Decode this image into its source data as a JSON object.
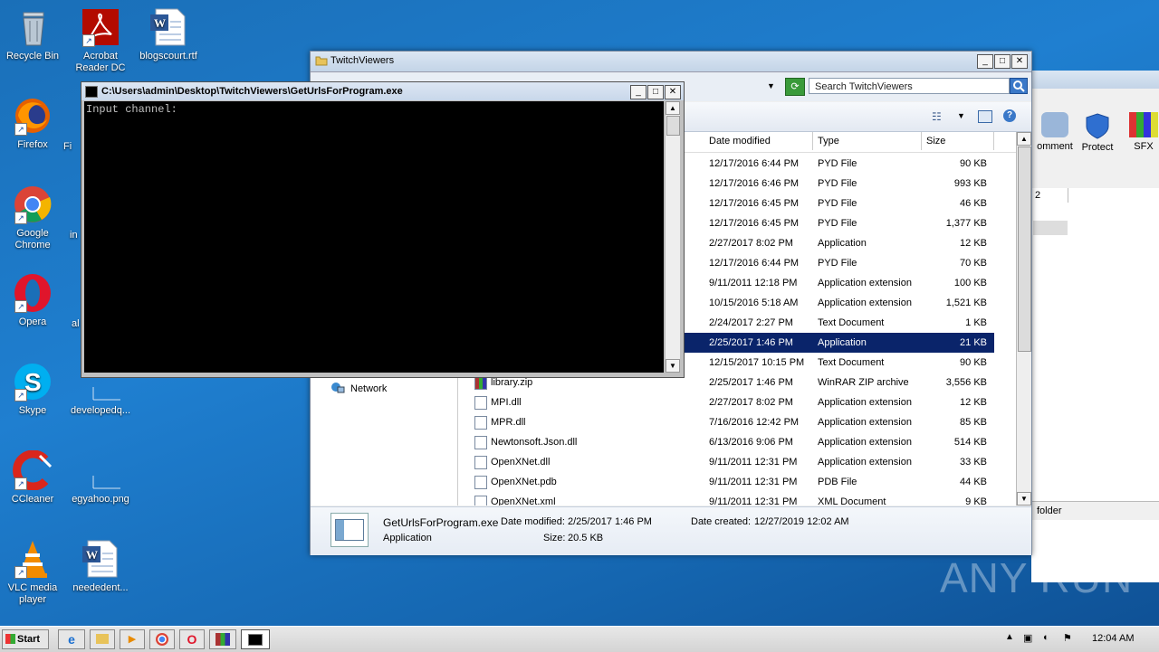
{
  "desktop": {
    "icons": [
      {
        "label": "Recycle Bin",
        "icon": "recycle-bin-icon"
      },
      {
        "label": "Acrobat Reader DC",
        "icon": "acrobat-icon"
      },
      {
        "label": "blogscourt.rtf",
        "icon": "word-doc-icon"
      },
      {
        "label": "Firefox",
        "icon": "firefox-icon"
      },
      {
        "label": "Fi",
        "icon": "file-icon"
      },
      {
        "label": "Google Chrome",
        "icon": "chrome-icon"
      },
      {
        "label": "in",
        "icon": "file-icon"
      },
      {
        "label": "Opera",
        "icon": "opera-icon"
      },
      {
        "label": "al",
        "icon": "file-icon"
      },
      {
        "label": "Skype",
        "icon": "skype-icon"
      },
      {
        "label": "developedq...",
        "icon": "file-icon"
      },
      {
        "label": "CCleaner",
        "icon": "ccleaner-icon"
      },
      {
        "label": "egyahoo.png",
        "icon": "image-file-icon"
      },
      {
        "label": "VLC media player",
        "icon": "vlc-icon"
      },
      {
        "label": "neededent...",
        "icon": "word-doc-icon"
      }
    ]
  },
  "explorer": {
    "title": "TwitchViewers",
    "search_placeholder": "Search TwitchViewers",
    "nav_network": "Network",
    "columns": {
      "date": "Date modified",
      "type": "Type",
      "size": "Size"
    },
    "rows": [
      {
        "name": "",
        "date": "12/17/2016 6:44 PM",
        "type": "PYD File",
        "size": "90 KB"
      },
      {
        "name": "",
        "date": "12/17/2016 6:46 PM",
        "type": "PYD File",
        "size": "993 KB"
      },
      {
        "name": "",
        "date": "12/17/2016 6:45 PM",
        "type": "PYD File",
        "size": "46 KB"
      },
      {
        "name": "",
        "date": "12/17/2016 6:45 PM",
        "type": "PYD File",
        "size": "1,377 KB"
      },
      {
        "name": "",
        "date": "2/27/2017 8:02 PM",
        "type": "Application",
        "size": "12 KB"
      },
      {
        "name": "",
        "date": "12/17/2016 6:44 PM",
        "type": "PYD File",
        "size": "70 KB"
      },
      {
        "name": "",
        "date": "9/11/2011 12:18 PM",
        "type": "Application extension",
        "size": "100 KB"
      },
      {
        "name": "",
        "date": "10/15/2016 5:18 AM",
        "type": "Application extension",
        "size": "1,521 KB"
      },
      {
        "name": "",
        "date": "2/24/2017 2:27 PM",
        "type": "Text Document",
        "size": "1 KB"
      },
      {
        "name": "",
        "date": "2/25/2017 1:46 PM",
        "type": "Application",
        "size": "21 KB",
        "selected": true
      },
      {
        "name": "",
        "date": "12/15/2017 10:15 PM",
        "type": "Text Document",
        "size": "90 KB"
      },
      {
        "name": "library.zip",
        "date": "2/25/2017 1:46 PM",
        "type": "WinRAR ZIP archive",
        "size": "3,556 KB"
      },
      {
        "name": "MPI.dll",
        "date": "2/27/2017 8:02 PM",
        "type": "Application extension",
        "size": "12 KB"
      },
      {
        "name": "MPR.dll",
        "date": "7/16/2016 12:42 PM",
        "type": "Application extension",
        "size": "85 KB"
      },
      {
        "name": "Newtonsoft.Json.dll",
        "date": "6/13/2016 9:06 PM",
        "type": "Application extension",
        "size": "514 KB"
      },
      {
        "name": "OpenXNet.dll",
        "date": "9/11/2011 12:31 PM",
        "type": "Application extension",
        "size": "33 KB"
      },
      {
        "name": "OpenXNet.pdb",
        "date": "9/11/2011 12:31 PM",
        "type": "PDB File",
        "size": "44 KB"
      },
      {
        "name": "OpenXNet.xml",
        "date": "9/11/2011 12:31 PM",
        "type": "XML Document",
        "size": "9 KB"
      }
    ],
    "details": {
      "filename": "GetUrlsForProgram.exe",
      "date_modified_label": "Date modified:",
      "date_modified": "2/25/2017 1:46 PM",
      "date_created_label": "Date created:",
      "date_created": "12/27/2019 12:02 AM",
      "type": "Application",
      "size_label": "Size:",
      "size": "20.5 KB"
    }
  },
  "background_window": {
    "toolbar_items": [
      "omment",
      "Protect",
      "SFX"
    ],
    "col_label": "2",
    "status_text": "folder"
  },
  "console": {
    "title": "C:\\Users\\admin\\Desktop\\TwitchViewers\\GetUrlsForProgram.exe",
    "output": "Input channel:"
  },
  "taskbar": {
    "start_label": "Start",
    "clock": "12:04 AM"
  },
  "watermark": "ANY RUN"
}
